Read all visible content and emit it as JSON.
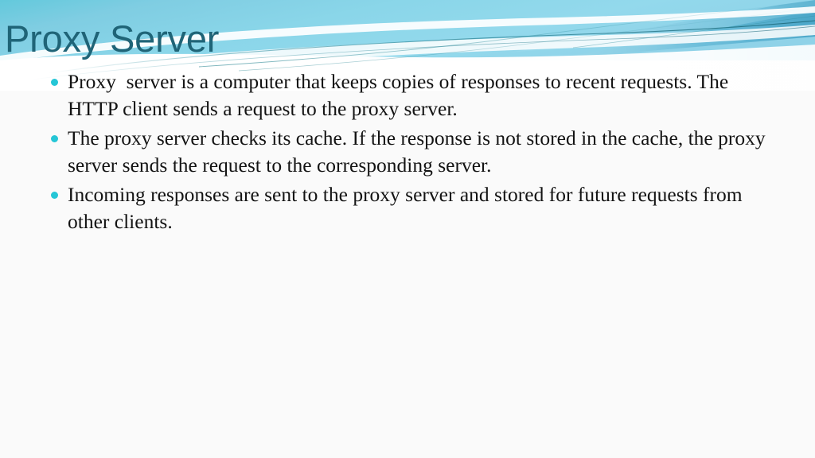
{
  "slide": {
    "title": "Proxy Server",
    "title_color": "#1f6477",
    "background_color": "#fafafa",
    "bullet_color": "#25c6d6",
    "body_text_color": "#131313",
    "header_gradient": {
      "left": "#7ec8dd",
      "mid": "#86d3e8",
      "right": "#9ad9ea",
      "accent_band": "#57b6d4",
      "hairline": "#1f7f8c"
    },
    "bullets": [
      {
        "text": "Proxy  server is a computer that keeps copies of responses to recent requests. The HTTP client sends a request to the proxy server."
      },
      {
        "text": "The proxy server checks its cache. If the response is not stored in the cache, the proxy server sends the request to the corresponding server."
      },
      {
        "text": "Incoming responses are sent to the proxy server and stored for future requests from other clients."
      }
    ]
  }
}
